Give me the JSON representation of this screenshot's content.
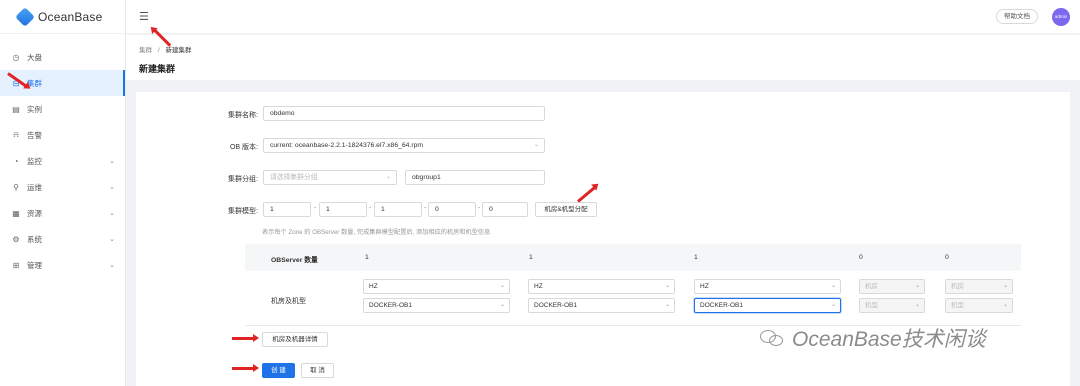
{
  "app": {
    "logo_text": "OceanBase"
  },
  "sidebar": {
    "items": [
      {
        "label": "大盘",
        "icon": "clock-icon"
      },
      {
        "label": "集群",
        "icon": "cluster-icon",
        "active": true
      },
      {
        "label": "实例",
        "icon": "instance-icon"
      },
      {
        "label": "告警",
        "icon": "bell-icon"
      },
      {
        "label": "监控",
        "icon": "monitor-icon",
        "expandable": true
      },
      {
        "label": "运维",
        "icon": "wrench-icon",
        "expandable": true
      },
      {
        "label": "资源",
        "icon": "resource-icon",
        "expandable": true
      },
      {
        "label": "系统",
        "icon": "gear-icon",
        "expandable": true
      },
      {
        "label": "管理",
        "icon": "grid-icon",
        "expandable": true
      }
    ]
  },
  "header": {
    "help_label": "帮助文档",
    "avatar_text": "admin"
  },
  "breadcrumb": {
    "parent": "集群",
    "separator": "/",
    "current": "新建集群"
  },
  "page": {
    "title": "新建集群"
  },
  "form": {
    "name_label": "集群名称:",
    "name_value": "obdemo",
    "version_label": "OB 版本:",
    "version_value": "current: oceanbase-2.2.1-1824376.el7.x86_64.rpm",
    "group_label": "集群分组:",
    "group_placeholder": "请选择集群分组",
    "group_value": "obgroup1",
    "model_label": "集群模型:",
    "model_values": [
      "1",
      "1",
      "1",
      "0",
      "0"
    ],
    "model_separator": "-",
    "allocate_button": "机房&机型分配",
    "hint": "表示每个 Zone 的 OBServer 数量, 完成集群模型配置后, 添加相应的机房和机型信息",
    "table": {
      "header_label": "OBServer 数量",
      "counts": [
        "1",
        "1",
        "1",
        "0",
        "0"
      ],
      "row_label": "机房及机型",
      "rooms": [
        "HZ",
        "HZ",
        "HZ"
      ],
      "machines": [
        "DOCKER-OB1",
        "DOCKER-OB1",
        "DOCKER-OB1"
      ],
      "disabled_room": "机房",
      "disabled_machine": "机型"
    },
    "details_button": "机房及机器详情",
    "create_button": "创 建",
    "cancel_button": "取 消"
  },
  "watermark": {
    "text": "OceanBase技术闲谈"
  },
  "colors": {
    "primary": "#1f72e8",
    "annotation_arrow": "#e02424"
  }
}
